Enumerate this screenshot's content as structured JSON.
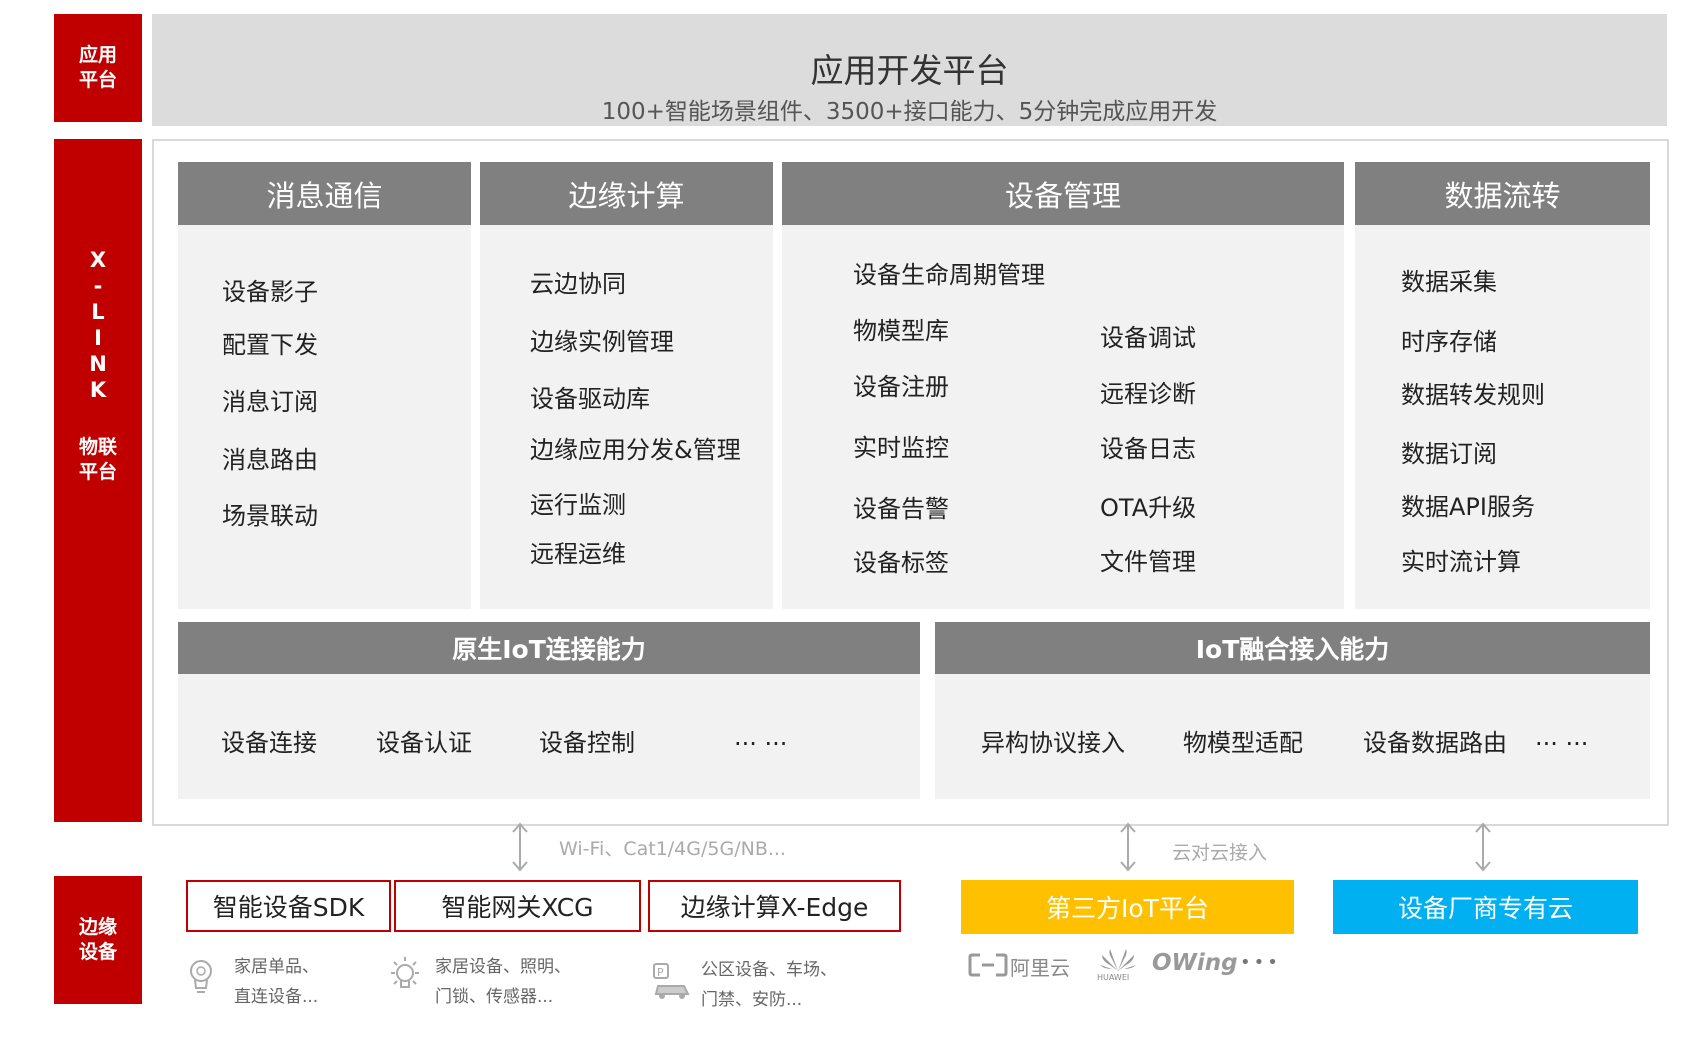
{
  "side_labels": {
    "app": [
      "应用",
      "平台"
    ],
    "xlink_letters": [
      "X",
      "-",
      "L",
      "I",
      "N",
      "K"
    ],
    "xlink_sub": [
      "物联",
      "平台"
    ],
    "edge": [
      "边缘",
      "设备"
    ]
  },
  "app_platform": {
    "title": "应用开发平台",
    "subtitle": "100+智能场景组件、3500+接口能力、5分钟完成应用开发"
  },
  "columns": [
    {
      "title": "消息通信",
      "items": [
        "设备影子",
        "配置下发",
        "消息订阅",
        "消息路由",
        "场景联动"
      ]
    },
    {
      "title": "边缘计算",
      "items": [
        "云边协同",
        "边缘实例管理",
        "设备驱动库",
        "边缘应用分发&管理",
        "运行监测",
        "远程运维"
      ]
    },
    {
      "title": "设备管理",
      "header_item": "设备生命周期管理",
      "left_items": [
        "物模型库",
        "设备注册",
        "实时监控",
        "设备告警",
        "设备标签"
      ],
      "right_items": [
        "设备调试",
        "远程诊断",
        "设备日志",
        "OTA升级",
        "文件管理"
      ]
    },
    {
      "title": "数据流转",
      "items": [
        "数据采集",
        "时序存储",
        "数据转发规则",
        "数据订阅",
        "数据API服务",
        "实时流计算"
      ]
    }
  ],
  "bands": [
    {
      "title": "原生IoT连接能力",
      "items": [
        "设备连接",
        "设备认证",
        "设备控制",
        "... ..."
      ]
    },
    {
      "title": "IoT融合接入能力",
      "items": [
        "异构协议接入",
        "物模型适配",
        "设备数据路由",
        "... ..."
      ]
    }
  ],
  "connections": {
    "left_label": "Wi-Fi、Cat1/4G/5G/NB...",
    "right_label": "云对云接入"
  },
  "devices": [
    {
      "label": "智能设备SDK",
      "desc": [
        "家居单品、",
        "直连设备..."
      ],
      "icon": "lightbulb-icon"
    },
    {
      "label": "智能网关XCG",
      "desc": [
        "家居设备、照明、",
        "门锁、传感器..."
      ],
      "icon": "bright-bulb-icon"
    },
    {
      "label": "边缘计算X-Edge",
      "desc": [
        "公区设备、车场、",
        "门禁、安防..."
      ],
      "icon": "parking-car-icon"
    }
  ],
  "clouds": [
    {
      "label": "第三方IoT平台",
      "color": "#ffc000"
    },
    {
      "label": "设备厂商专有云",
      "color": "#00b0f0"
    }
  ],
  "partner_logos": {
    "aliyun": "阿里云",
    "huawei": "HUAWEI",
    "owing": "OWing",
    "more": "•••"
  },
  "colors": {
    "side_red": "#c00000",
    "header_gray": "#808080",
    "panel_gray": "#f2f2f2",
    "top_gray": "#dcdcdc"
  }
}
